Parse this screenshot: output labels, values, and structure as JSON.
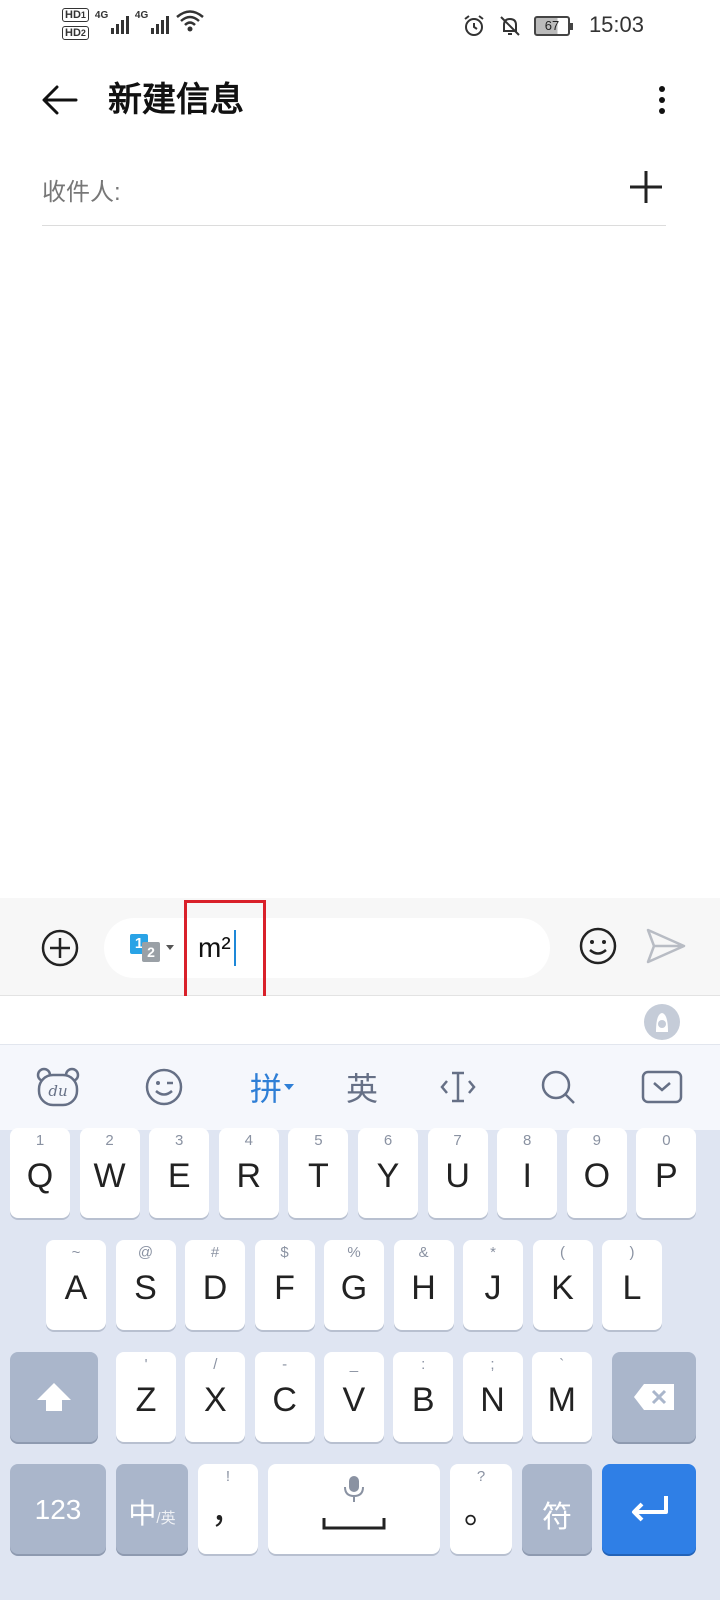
{
  "status_bar": {
    "hd1": "HD",
    "hd1_sub": "1",
    "hd2": "HD",
    "hd2_sub": "2",
    "sim1_net": "4G",
    "sim2_net": "4G",
    "battery": "67",
    "time": "15:03",
    "icons": [
      "signal-icon",
      "wifi-icon",
      "alarm-icon",
      "bell-off-icon",
      "battery-icon"
    ]
  },
  "header": {
    "title": "新建信息"
  },
  "recipient": {
    "label": "收件人:"
  },
  "compose": {
    "text": "m²",
    "ime_badge_1": "1",
    "ime_badge_2": "2"
  },
  "keyboard": {
    "toolbar": {
      "pinyin": "拼",
      "english": "英"
    },
    "row1": [
      {
        "main": "Q",
        "sub": "1"
      },
      {
        "main": "W",
        "sub": "2"
      },
      {
        "main": "E",
        "sub": "3"
      },
      {
        "main": "R",
        "sub": "4"
      },
      {
        "main": "T",
        "sub": "5"
      },
      {
        "main": "Y",
        "sub": "6"
      },
      {
        "main": "U",
        "sub": "7"
      },
      {
        "main": "I",
        "sub": "8"
      },
      {
        "main": "O",
        "sub": "9"
      },
      {
        "main": "P",
        "sub": "0"
      }
    ],
    "row2": [
      {
        "main": "A",
        "sub": "~"
      },
      {
        "main": "S",
        "sub": "@"
      },
      {
        "main": "D",
        "sub": "#"
      },
      {
        "main": "F",
        "sub": "$"
      },
      {
        "main": "G",
        "sub": "%"
      },
      {
        "main": "H",
        "sub": "&"
      },
      {
        "main": "J",
        "sub": "*"
      },
      {
        "main": "K",
        "sub": "("
      },
      {
        "main": "L",
        "sub": ")"
      }
    ],
    "row3": [
      {
        "main": "Z",
        "sub": "'"
      },
      {
        "main": "X",
        "sub": "/"
      },
      {
        "main": "C",
        "sub": "-"
      },
      {
        "main": "V",
        "sub": "_"
      },
      {
        "main": "B",
        "sub": ":"
      },
      {
        "main": "N",
        "sub": ";"
      },
      {
        "main": "M",
        "sub": "`"
      }
    ],
    "num_key": "123",
    "lang_key": "中",
    "lang_key_sub": "/英",
    "comma_key": "，",
    "comma_sub": "!",
    "period_key": "。",
    "period_sub": "?",
    "symbol_key": "符"
  },
  "colors": {
    "accent": "#2f7fe6",
    "highlight": "#d9202a",
    "keyboard_bg": "#dfe5f2"
  }
}
